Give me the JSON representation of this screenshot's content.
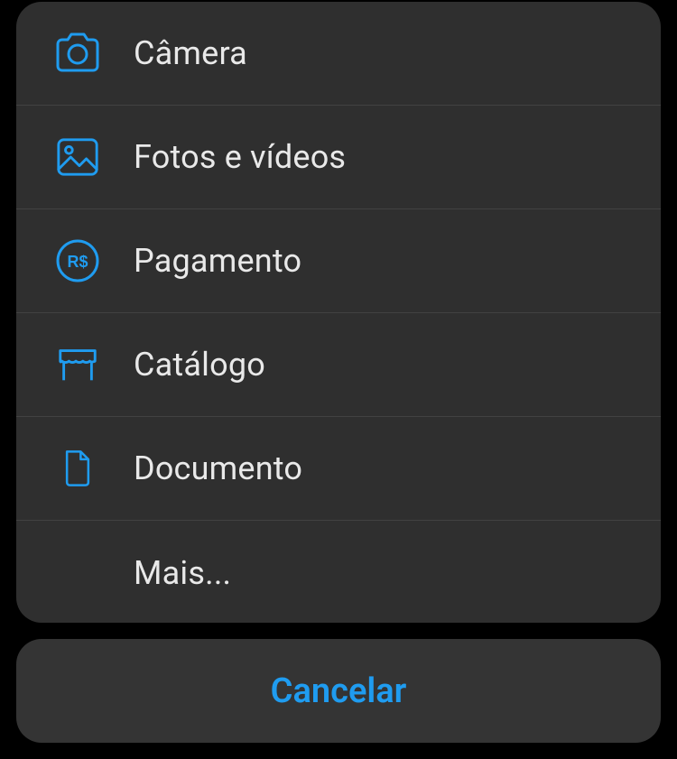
{
  "menu": {
    "items": [
      {
        "label": "Câmera",
        "icon": "camera-icon"
      },
      {
        "label": "Fotos e vídeos",
        "icon": "photo-icon"
      },
      {
        "label": "Pagamento",
        "icon": "payment-icon"
      },
      {
        "label": "Catálogo",
        "icon": "catalog-icon"
      },
      {
        "label": "Documento",
        "icon": "document-icon"
      },
      {
        "label": "Mais...",
        "icon": ""
      }
    ],
    "cancel_label": "Cancelar"
  },
  "colors": {
    "accent": "#1f9cf0",
    "sheet_bg": "rgba(50,50,50,0.95)",
    "text": "#e9e9e9"
  }
}
